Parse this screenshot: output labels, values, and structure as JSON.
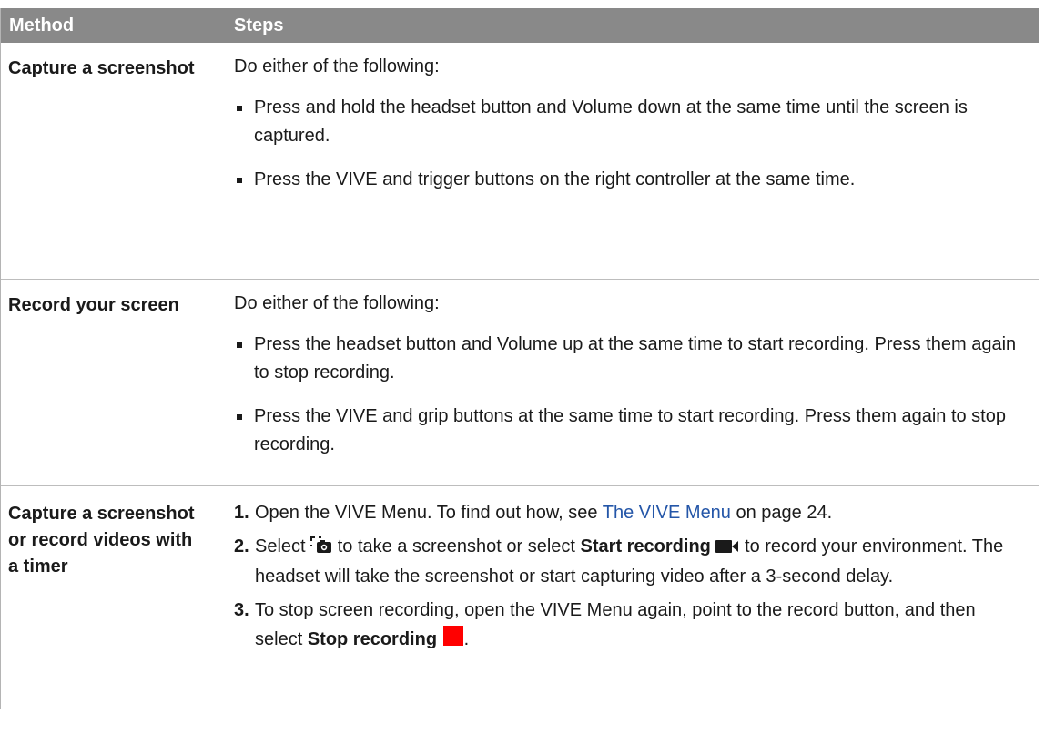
{
  "header": {
    "method": "Method",
    "steps": "Steps"
  },
  "rows": [
    {
      "method": "Capture a screenshot",
      "intro": "Do either of the following:",
      "bullets": [
        "Press and hold the headset button and Volume down at the same time until the screen is captured.",
        "Press the VIVE and trigger buttons on the right controller at the same time."
      ]
    },
    {
      "method": "Record your screen",
      "intro": "Do either of the following:",
      "bullets": [
        "Press the headset button and Volume up at the same time to start recording. Press them again to stop recording.",
        "Press the VIVE and grip buttons at the same time to start recording. Press them again to stop recording."
      ]
    },
    {
      "method": "Capture a screenshot or record videos with a timer",
      "steps": {
        "s1": {
          "num": "1.",
          "text_a": "Open the VIVE Menu. To find out how, see ",
          "link": "The VIVE Menu",
          "text_b": " on page 24."
        },
        "s2": {
          "num": "2.",
          "text_a": "Select ",
          "text_b": " to take a screenshot or select ",
          "bold": "Start recording",
          "text_c": " to record your environment. The headset will take the screenshot or start capturing video after a 3-second delay."
        },
        "s3": {
          "num": "3.",
          "text_a": "To stop screen recording, open the VIVE Menu again, point to the record button, and then select ",
          "bold": "Stop recording",
          "text_b": "."
        }
      }
    }
  ],
  "icons": {
    "screenshot": "screenshot-timer-icon",
    "start_recording": "video-camera-icon",
    "stop_recording": "stop-square-icon"
  },
  "colors": {
    "header_bg": "#898989",
    "link": "#2456a8",
    "stop_red": "#ff0000"
  }
}
